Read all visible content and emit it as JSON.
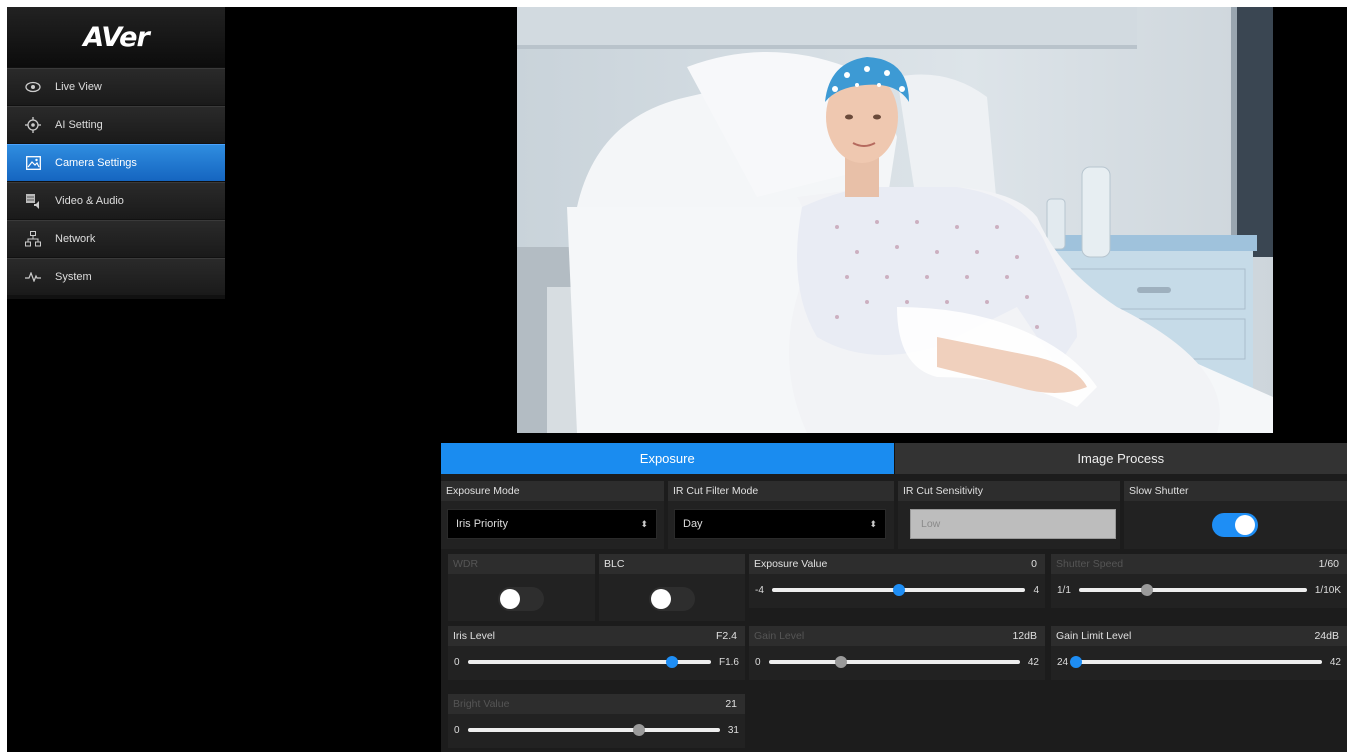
{
  "app": {
    "logo_text": "AVer"
  },
  "sidebar": {
    "items": [
      {
        "label": "Live View",
        "icon": "eye-icon"
      },
      {
        "label": "AI Setting",
        "icon": "crosshair-icon"
      },
      {
        "label": "Camera Settings",
        "icon": "image-icon",
        "active": true
      },
      {
        "label": "Video & Audio",
        "icon": "video-audio-icon"
      },
      {
        "label": "Network",
        "icon": "network-icon"
      },
      {
        "label": "System",
        "icon": "pulse-icon"
      }
    ]
  },
  "tabs": {
    "exposure": "Exposure",
    "image_process": "Image Process"
  },
  "exposure_mode": {
    "label": "Exposure Mode",
    "value": "Iris Priority"
  },
  "ir_cut_filter_mode": {
    "label": "IR Cut Filter Mode",
    "value": "Day"
  },
  "ir_cut_sensitivity": {
    "label": "IR Cut Sensitivity",
    "value": "Low"
  },
  "slow_shutter": {
    "label": "Slow Shutter",
    "on": true
  },
  "wdr": {
    "label": "WDR",
    "on": false
  },
  "blc": {
    "label": "BLC",
    "on": false
  },
  "exposure_value": {
    "label": "Exposure Value",
    "value": "0",
    "min": "-4",
    "max": "4",
    "fraction": 0.5
  },
  "shutter_speed": {
    "label": "Shutter Speed",
    "value": "1/60",
    "min": "1/1",
    "max": "1/10K",
    "fraction": 0.3
  },
  "iris_level": {
    "label": "Iris Level",
    "value": "F2.4",
    "min": "0",
    "max": "F1.6",
    "fraction": 0.84
  },
  "gain_level": {
    "label": "Gain Level",
    "value": "12dB",
    "min": "0",
    "max": "42",
    "fraction": 0.29
  },
  "gain_limit_level": {
    "label": "Gain Limit Level",
    "value": "24dB",
    "min": "24",
    "max": "42",
    "fraction": 0.0
  },
  "bright_value": {
    "label": "Bright Value",
    "value": "21",
    "min": "0",
    "max": "31",
    "fraction": 0.68
  },
  "colors": {
    "accent": "#1a8cf0",
    "panel_bg": "#1c1c1c",
    "sidebar_active": "#1e74d0"
  }
}
